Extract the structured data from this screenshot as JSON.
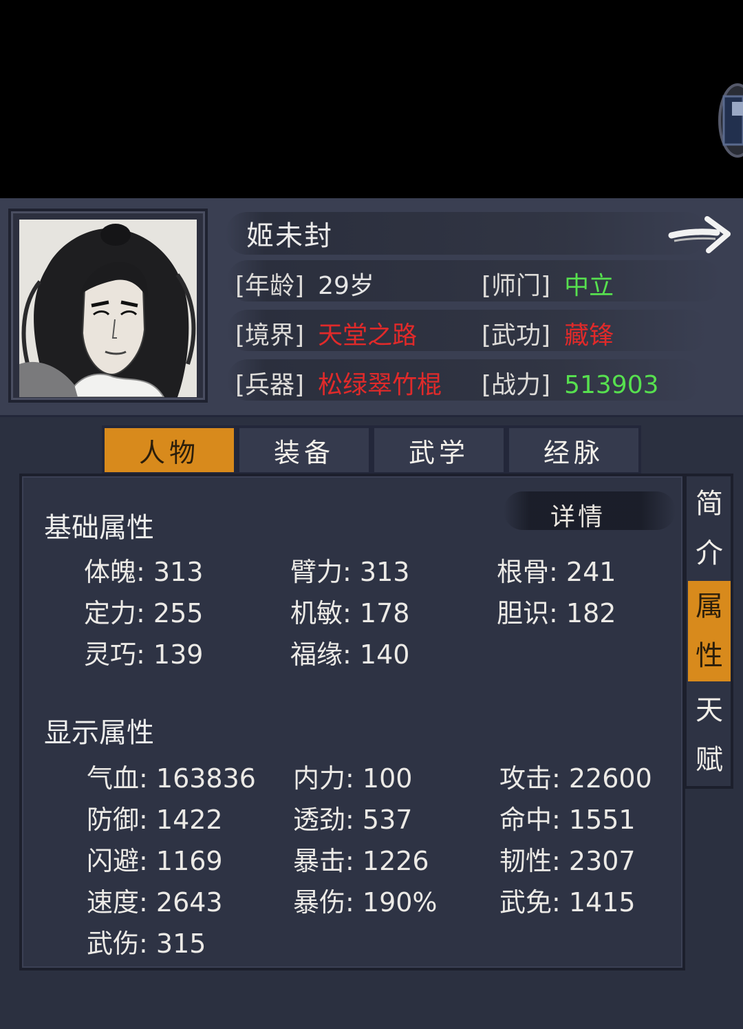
{
  "character": {
    "name": "姬未封",
    "rows": [
      {
        "label": "[年龄]",
        "value": "29岁",
        "color": "#e5e5e5"
      },
      {
        "label": "[师门]",
        "value": "中立",
        "color": "#57e04f"
      },
      {
        "label": "[境界]",
        "value": "天堂之路",
        "color": "#e02a2a"
      },
      {
        "label": "[武功]",
        "value": "藏锋",
        "color": "#e02a2a"
      },
      {
        "label": "[兵器]",
        "value": "松绿翠竹棍",
        "color": "#e02a2a"
      },
      {
        "label": "[战力]",
        "value": "513903",
        "color": "#57e04f"
      }
    ]
  },
  "tabs": [
    {
      "label": "人物",
      "active": true
    },
    {
      "label": "装备",
      "active": false
    },
    {
      "label": "武学",
      "active": false
    },
    {
      "label": "经脉",
      "active": false
    }
  ],
  "details_label": "详情",
  "base_section": {
    "title": "基础属性",
    "stats": [
      {
        "name": "体魄",
        "value": "313"
      },
      {
        "name": "臂力",
        "value": "313"
      },
      {
        "name": "根骨",
        "value": "241"
      },
      {
        "name": "定力",
        "value": "255"
      },
      {
        "name": "机敏",
        "value": "178"
      },
      {
        "name": "胆识",
        "value": "182"
      },
      {
        "name": "灵巧",
        "value": "139"
      },
      {
        "name": "福缘",
        "value": "140"
      }
    ]
  },
  "display_section": {
    "title": "显示属性",
    "stats": [
      {
        "name": "气血",
        "value": "163836"
      },
      {
        "name": "内力",
        "value": "100"
      },
      {
        "name": "攻击",
        "value": "22600"
      },
      {
        "name": "防御",
        "value": "1422"
      },
      {
        "name": "透劲",
        "value": "537"
      },
      {
        "name": "命中",
        "value": "1551"
      },
      {
        "name": "闪避",
        "value": "1169"
      },
      {
        "name": "暴击",
        "value": "1226"
      },
      {
        "name": "韧性",
        "value": "2307"
      },
      {
        "name": "速度",
        "value": "2643"
      },
      {
        "name": "暴伤",
        "value": "190%"
      },
      {
        "name": "武免",
        "value": "1415"
      },
      {
        "name": "武伤",
        "value": "315"
      }
    ]
  },
  "side_tabs": [
    {
      "chars": [
        "简",
        "介"
      ],
      "active": false
    },
    {
      "chars": [
        "属",
        "性"
      ],
      "active": true
    },
    {
      "chars": [
        "天",
        "赋"
      ],
      "active": false
    }
  ],
  "colors": {
    "accent": "#d88a1c",
    "panel": "#2b3040",
    "header": "#3a3f52",
    "green": "#57e04f",
    "red": "#e02a2a"
  },
  "icons": [
    "next-arrow-icon",
    "portrait-image"
  ]
}
